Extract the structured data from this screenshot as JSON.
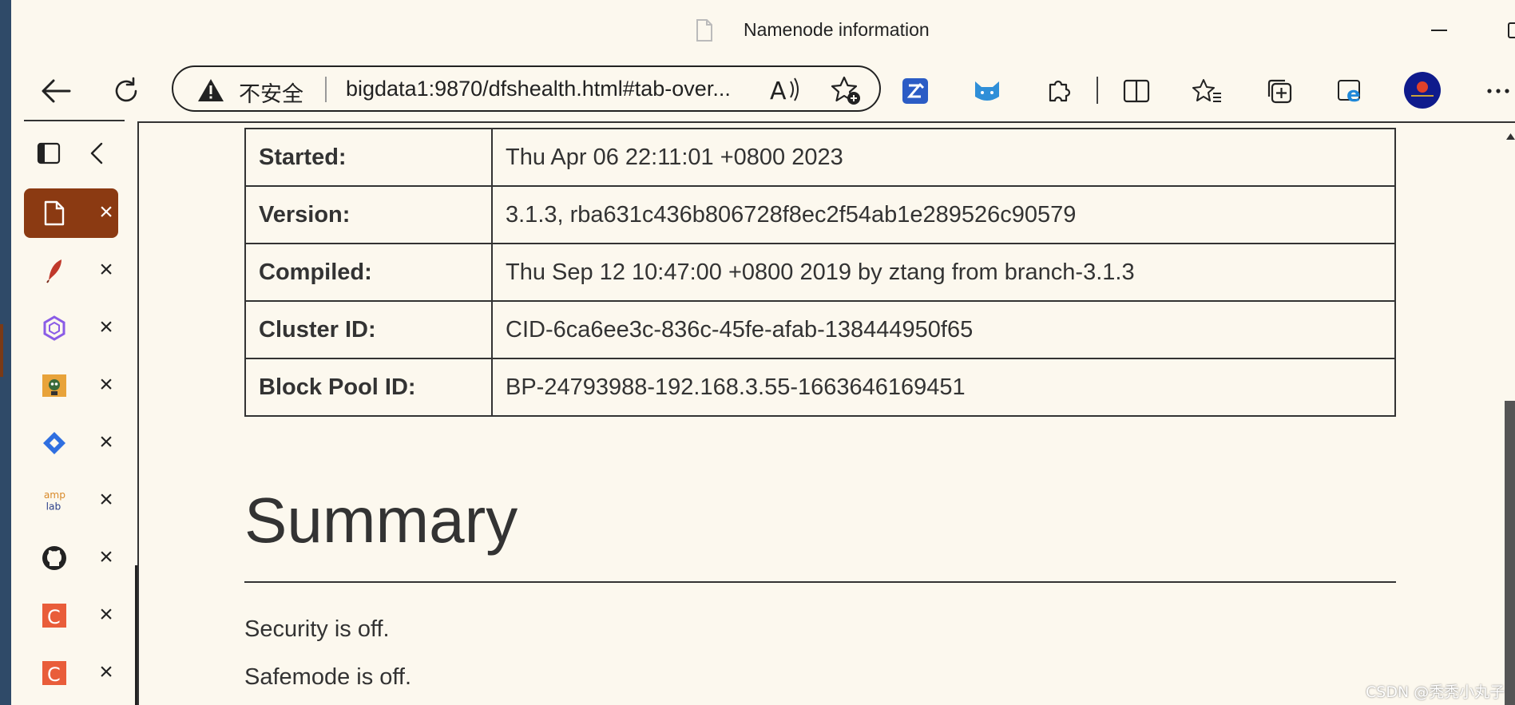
{
  "window": {
    "title": "Namenode information"
  },
  "navbar": {
    "security_label": "不安全",
    "url": "bigdata1:9870/dfshealth.html#tab-over..."
  },
  "tabs": [
    {
      "icon": "document-icon",
      "active": true
    },
    {
      "icon": "feather-icon",
      "active": false
    },
    {
      "icon": "hexagon-icon",
      "active": false
    },
    {
      "icon": "robot-icon",
      "active": false
    },
    {
      "icon": "diamond-icon",
      "active": false
    },
    {
      "icon": "amplab-icon",
      "label": "amp lab",
      "active": false
    },
    {
      "icon": "github-icon",
      "active": false
    },
    {
      "icon": "csdn-icon",
      "label": "C",
      "active": false
    },
    {
      "icon": "csdn-icon",
      "label": "C",
      "active": false
    }
  ],
  "info_table": [
    {
      "key": "Started:",
      "value": "Thu Apr 06 22:11:01 +0800 2023"
    },
    {
      "key": "Version:",
      "value": "3.1.3, rba631c436b806728f8ec2f54ab1e289526c90579"
    },
    {
      "key": "Compiled:",
      "value": "Thu Sep 12 10:47:00 +0800 2019 by ztang from branch-3.1.3"
    },
    {
      "key": "Cluster ID:",
      "value": "CID-6ca6ee3c-836c-45fe-afab-138444950f65"
    },
    {
      "key": "Block Pool ID:",
      "value": "BP-24793988-192.168.3.55-1663646169451"
    }
  ],
  "summary": {
    "title": "Summary",
    "security": "Security is off.",
    "safemode": "Safemode is off."
  },
  "watermark": "CSDN @秃秃小丸子",
  "colors": {
    "page_bg": "#fcf8ee",
    "active_tab": "#8b3a12",
    "text": "#333333"
  }
}
